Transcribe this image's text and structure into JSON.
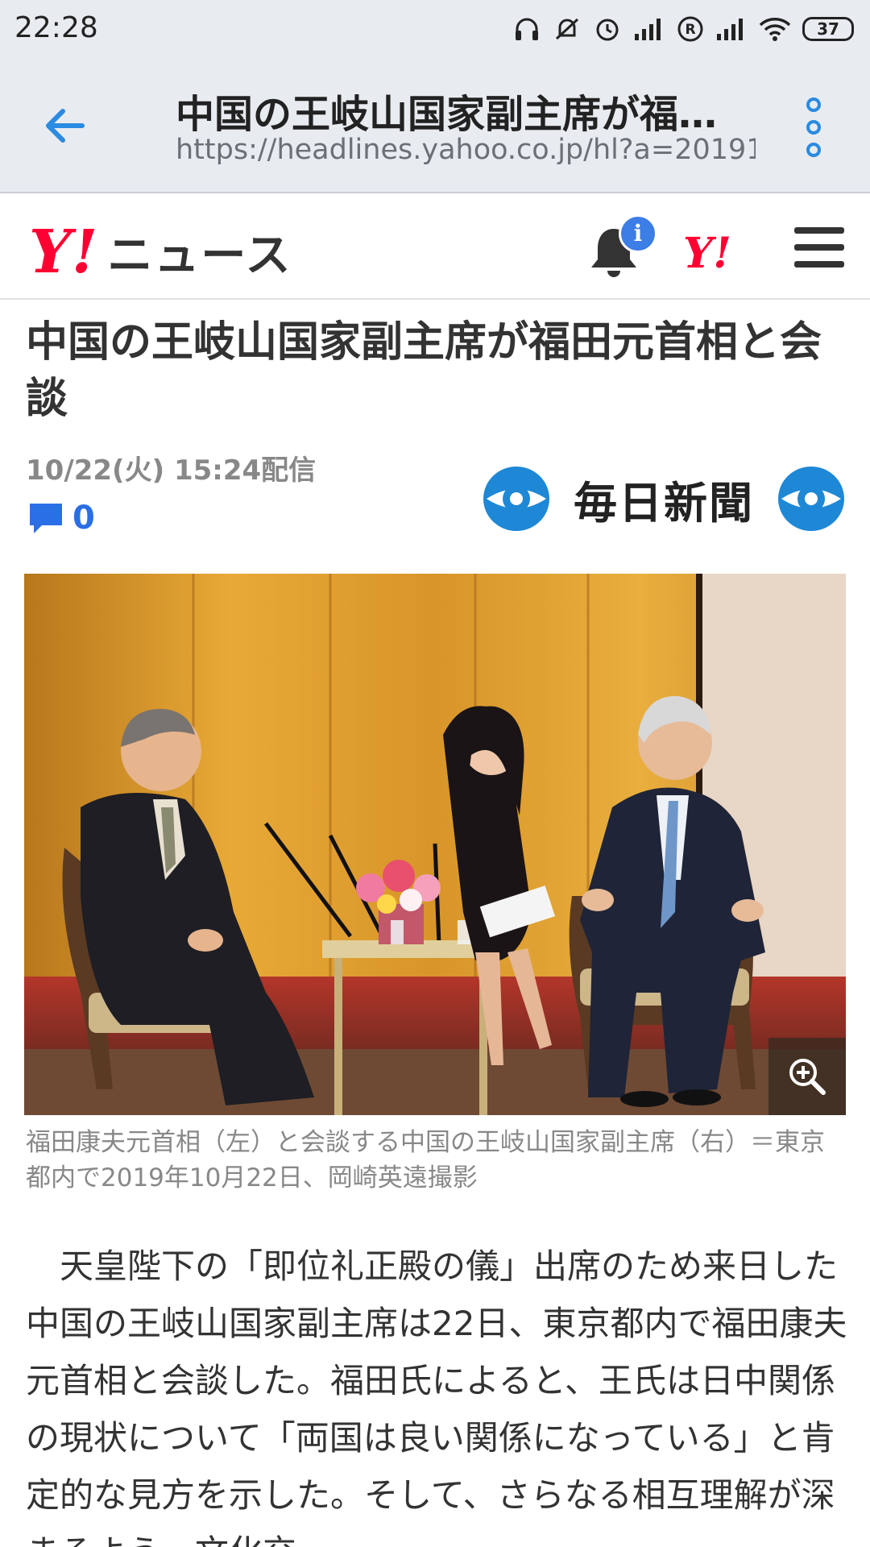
{
  "status_bar": {
    "time": "22:28",
    "battery": "37",
    "icons": [
      "headphones-icon",
      "mute-icon",
      "alarm-icon",
      "signal-icon",
      "roaming-icon",
      "signal-icon",
      "wifi-icon",
      "battery-icon"
    ]
  },
  "browser": {
    "title": "中国の王岐山国家副主席が福田元首相と会談",
    "url": "https://headlines.yahoo.co.jp/hl?a=20191("
  },
  "site_header": {
    "logo_y": "Y!",
    "logo_news": "ニュース",
    "notification_badge": "i",
    "yahoo_mark": "Y!"
  },
  "article": {
    "headline": "中国の王岐山国家副主席が福田元首相と会談",
    "published": "10/22(火) 15:24配信",
    "comment_count": "0",
    "source_name": "毎日新聞",
    "photo_caption": "福田康夫元首相（左）と会談する中国の王岐山国家副主席（右）＝東京都内で2019年10月22日、岡崎英遠撮影",
    "body": "　天皇陛下の「即位礼正殿の儀」出席のため来日した中国の王岐山国家副主席は22日、東京都内で福田康夫元首相と会談した。福田氏によると、王氏は日中関係の現状について「両国は良い関係になっている」と肯定的な見方を示した。そして、さらなる相互理解が深まるよう、文化交"
  },
  "colors": {
    "yahoo_red": "#ff0033",
    "link_blue": "#2a6fe6",
    "badge_blue": "#3c7de6",
    "chrome_bg": "#e8ebf0"
  }
}
